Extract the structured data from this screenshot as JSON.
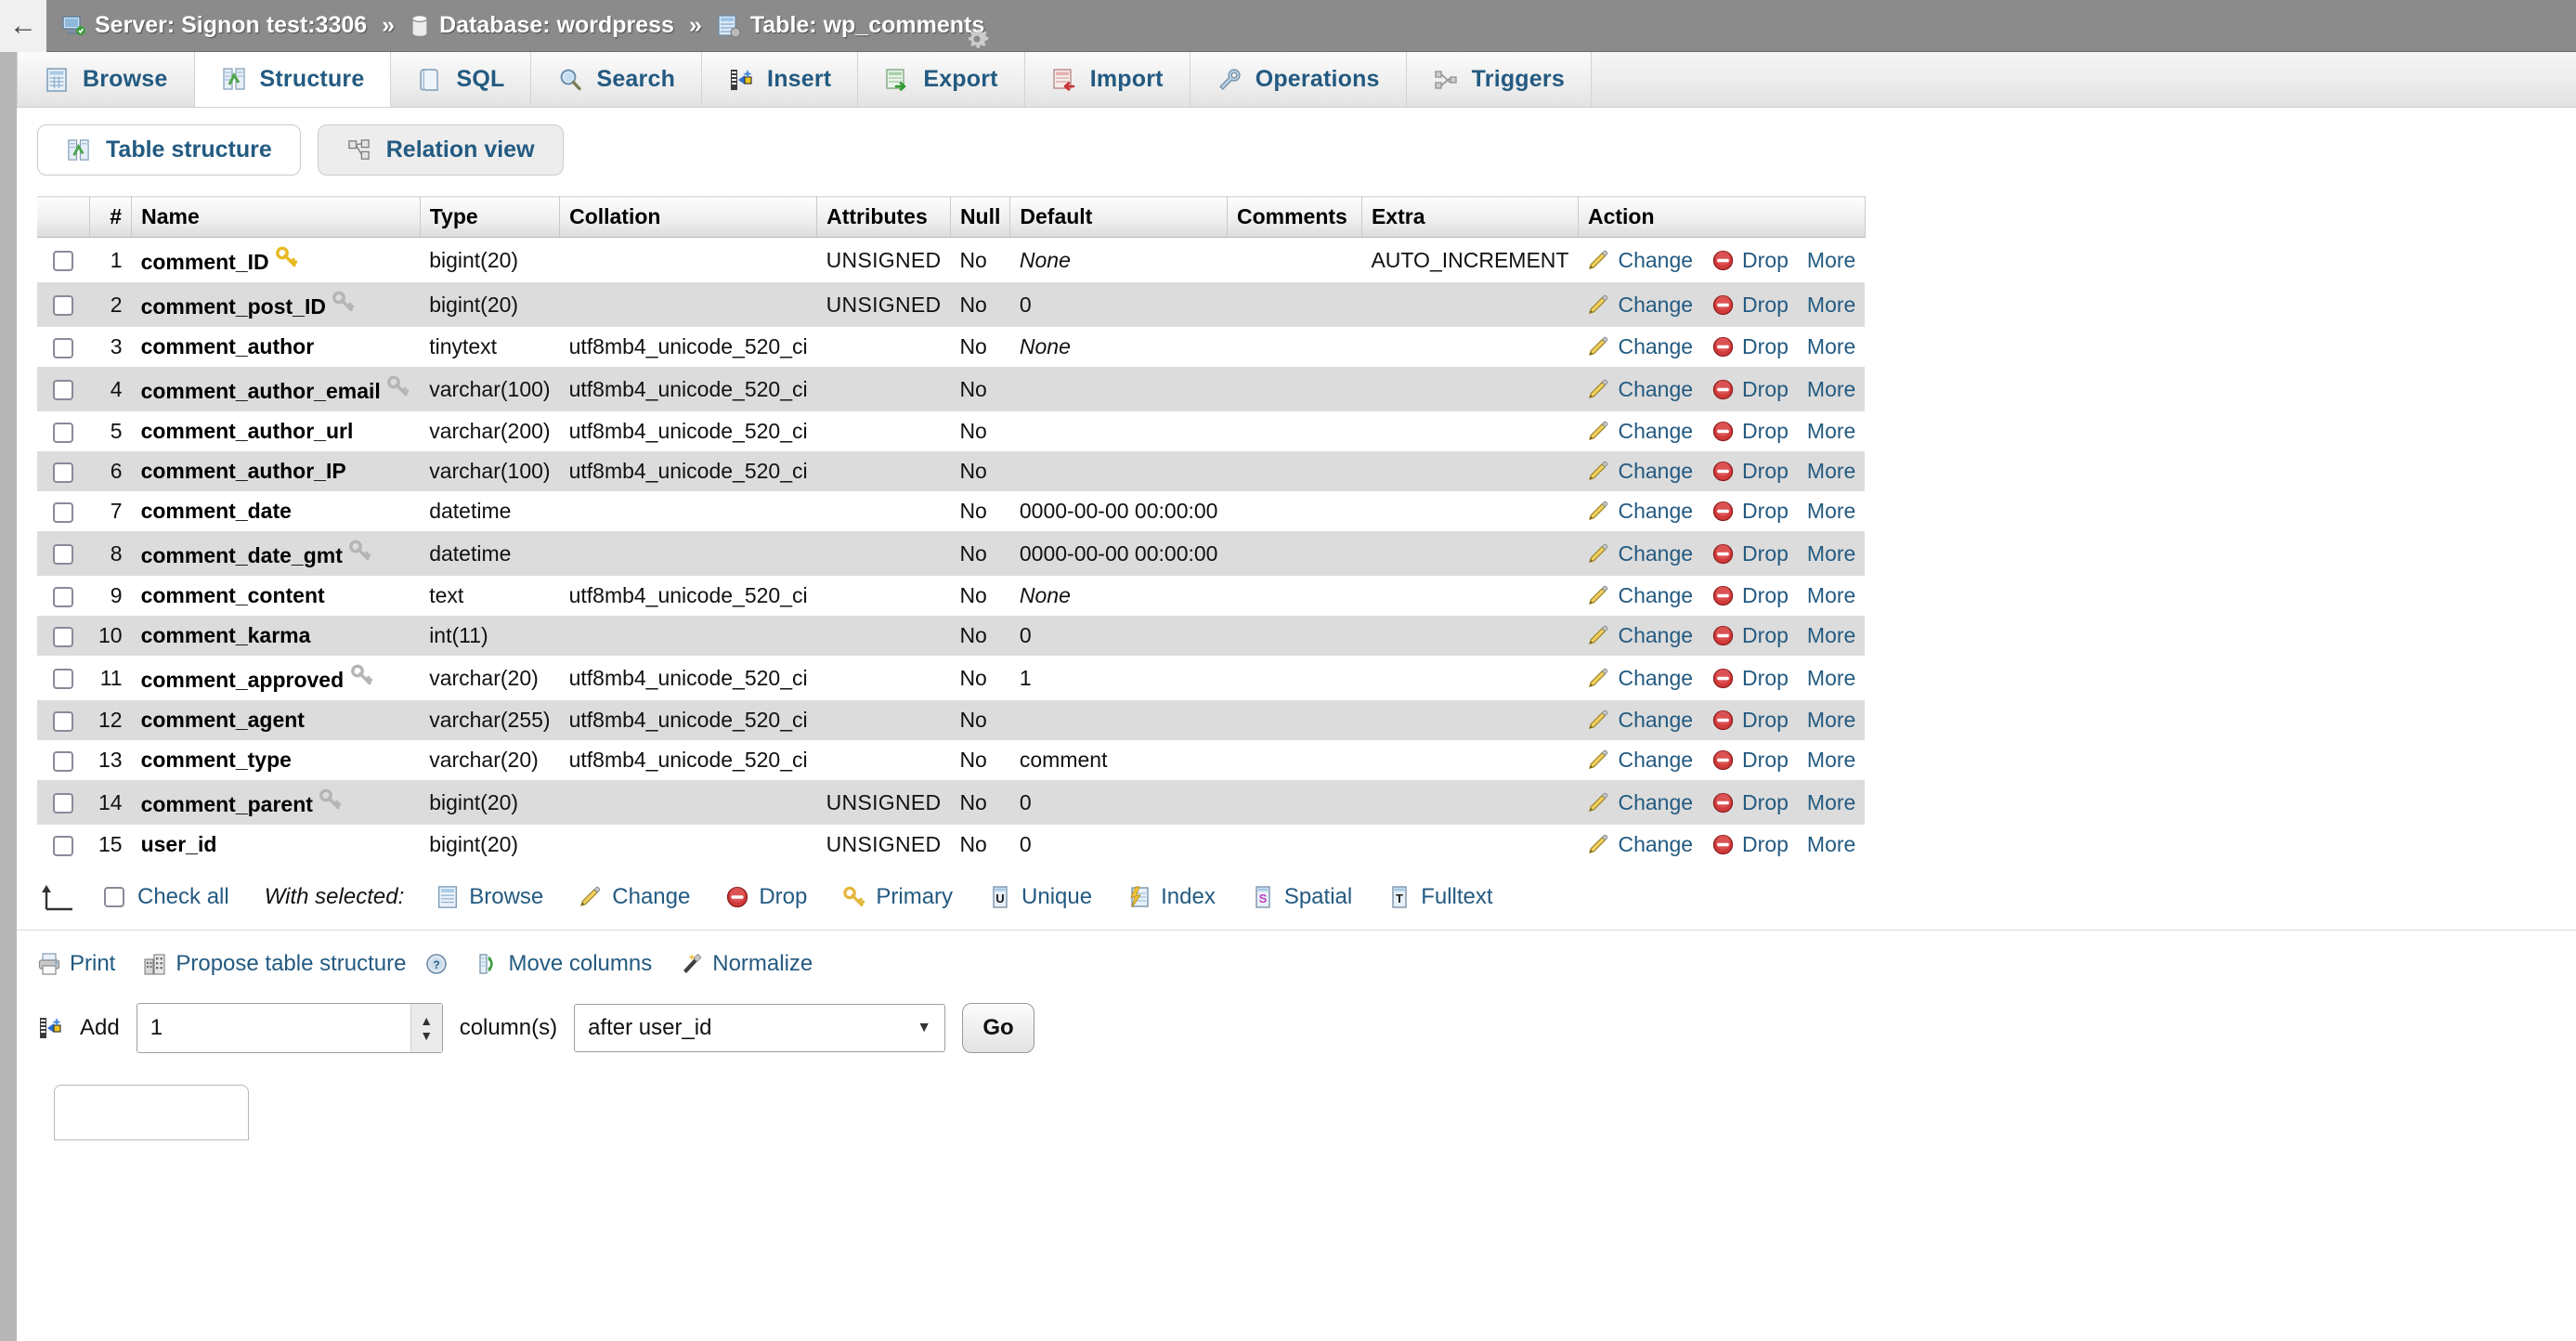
{
  "breadcrumb": {
    "back_icon": "back-arrow-icon",
    "items": [
      {
        "icon": "server-icon",
        "label": "Server: Signon test:3306"
      },
      {
        "icon": "database-icon",
        "label": "Database: wordpress"
      },
      {
        "icon": "table-icon",
        "label": "Table: wp_comments"
      }
    ],
    "separator": "»",
    "settings_icon": "gear-icon"
  },
  "nav_tabs": [
    {
      "label": "Browse",
      "icon": "browse-icon",
      "active": false
    },
    {
      "label": "Structure",
      "icon": "structure-icon",
      "active": true
    },
    {
      "label": "SQL",
      "icon": "sql-icon",
      "active": false
    },
    {
      "label": "Search",
      "icon": "search-icon",
      "active": false
    },
    {
      "label": "Insert",
      "icon": "insert-icon",
      "active": false
    },
    {
      "label": "Export",
      "icon": "export-icon",
      "active": false
    },
    {
      "label": "Import",
      "icon": "import-icon",
      "active": false
    },
    {
      "label": "Operations",
      "icon": "operations-icon",
      "active": false
    },
    {
      "label": "Triggers",
      "icon": "triggers-icon",
      "active": false
    }
  ],
  "sub_tabs": [
    {
      "label": "Table structure",
      "icon": "structure-icon",
      "active": true
    },
    {
      "label": "Relation view",
      "icon": "relation-icon",
      "active": false
    }
  ],
  "table": {
    "columns": [
      "#",
      "Name",
      "Type",
      "Collation",
      "Attributes",
      "Null",
      "Default",
      "Comments",
      "Extra",
      "Action"
    ],
    "action_labels": {
      "change": "Change",
      "drop": "Drop",
      "more": "More"
    },
    "rows": [
      {
        "num": "1",
        "name": "comment_ID",
        "key": "primary",
        "type": "bigint(20)",
        "collation": "",
        "attributes": "UNSIGNED",
        "null": "No",
        "default": "None",
        "default_italic": true,
        "comments": "",
        "extra": "AUTO_INCREMENT"
      },
      {
        "num": "2",
        "name": "comment_post_ID",
        "key": "index",
        "type": "bigint(20)",
        "collation": "",
        "attributes": "UNSIGNED",
        "null": "No",
        "default": "0",
        "default_italic": false,
        "comments": "",
        "extra": ""
      },
      {
        "num": "3",
        "name": "comment_author",
        "key": "none",
        "type": "tinytext",
        "collation": "utf8mb4_unicode_520_ci",
        "attributes": "",
        "null": "No",
        "default": "None",
        "default_italic": true,
        "comments": "",
        "extra": ""
      },
      {
        "num": "4",
        "name": "comment_author_email",
        "key": "index",
        "type": "varchar(100)",
        "collation": "utf8mb4_unicode_520_ci",
        "attributes": "",
        "null": "No",
        "default": "",
        "default_italic": false,
        "comments": "",
        "extra": ""
      },
      {
        "num": "5",
        "name": "comment_author_url",
        "key": "none",
        "type": "varchar(200)",
        "collation": "utf8mb4_unicode_520_ci",
        "attributes": "",
        "null": "No",
        "default": "",
        "default_italic": false,
        "comments": "",
        "extra": ""
      },
      {
        "num": "6",
        "name": "comment_author_IP",
        "key": "none",
        "type": "varchar(100)",
        "collation": "utf8mb4_unicode_520_ci",
        "attributes": "",
        "null": "No",
        "default": "",
        "default_italic": false,
        "comments": "",
        "extra": ""
      },
      {
        "num": "7",
        "name": "comment_date",
        "key": "none",
        "type": "datetime",
        "collation": "",
        "attributes": "",
        "null": "No",
        "default": "0000-00-00 00:00:00",
        "default_italic": false,
        "comments": "",
        "extra": ""
      },
      {
        "num": "8",
        "name": "comment_date_gmt",
        "key": "index",
        "type": "datetime",
        "collation": "",
        "attributes": "",
        "null": "No",
        "default": "0000-00-00 00:00:00",
        "default_italic": false,
        "comments": "",
        "extra": ""
      },
      {
        "num": "9",
        "name": "comment_content",
        "key": "none",
        "type": "text",
        "collation": "utf8mb4_unicode_520_ci",
        "attributes": "",
        "null": "No",
        "default": "None",
        "default_italic": true,
        "comments": "",
        "extra": ""
      },
      {
        "num": "10",
        "name": "comment_karma",
        "key": "none",
        "type": "int(11)",
        "collation": "",
        "attributes": "",
        "null": "No",
        "default": "0",
        "default_italic": false,
        "comments": "",
        "extra": ""
      },
      {
        "num": "11",
        "name": "comment_approved",
        "key": "index",
        "type": "varchar(20)",
        "collation": "utf8mb4_unicode_520_ci",
        "attributes": "",
        "null": "No",
        "default": "1",
        "default_italic": false,
        "comments": "",
        "extra": ""
      },
      {
        "num": "12",
        "name": "comment_agent",
        "key": "none",
        "type": "varchar(255)",
        "collation": "utf8mb4_unicode_520_ci",
        "attributes": "",
        "null": "No",
        "default": "",
        "default_italic": false,
        "comments": "",
        "extra": ""
      },
      {
        "num": "13",
        "name": "comment_type",
        "key": "none",
        "type": "varchar(20)",
        "collation": "utf8mb4_unicode_520_ci",
        "attributes": "",
        "null": "No",
        "default": "comment",
        "default_italic": false,
        "comments": "",
        "extra": ""
      },
      {
        "num": "14",
        "name": "comment_parent",
        "key": "index",
        "type": "bigint(20)",
        "collation": "",
        "attributes": "UNSIGNED",
        "null": "No",
        "default": "0",
        "default_italic": false,
        "comments": "",
        "extra": ""
      },
      {
        "num": "15",
        "name": "user_id",
        "key": "none",
        "type": "bigint(20)",
        "collation": "",
        "attributes": "UNSIGNED",
        "null": "No",
        "default": "0",
        "default_italic": false,
        "comments": "",
        "extra": ""
      }
    ]
  },
  "with_selected": {
    "check_all": "Check all",
    "label": "With selected:",
    "actions": [
      {
        "label": "Browse",
        "icon": "browse-icon"
      },
      {
        "label": "Change",
        "icon": "pencil-icon"
      },
      {
        "label": "Drop",
        "icon": "drop-icon"
      },
      {
        "label": "Primary",
        "icon": "key-gold-icon"
      },
      {
        "label": "Unique",
        "icon": "unique-icon"
      },
      {
        "label": "Index",
        "icon": "index-icon"
      },
      {
        "label": "Spatial",
        "icon": "spatial-icon"
      },
      {
        "label": "Fulltext",
        "icon": "fulltext-icon"
      }
    ]
  },
  "bottom_tools": [
    {
      "label": "Print",
      "icon": "print-icon"
    },
    {
      "label": "Propose table structure",
      "icon": "propose-icon",
      "help_icon": "help-icon"
    },
    {
      "label": "Move columns",
      "icon": "move-columns-icon"
    },
    {
      "label": "Normalize",
      "icon": "normalize-icon"
    }
  ],
  "add_form": {
    "icon": "insert-icon",
    "add_label": "Add",
    "count_value": "1",
    "columns_label": "column(s)",
    "position_value": "after user_id",
    "go_label": "Go"
  },
  "colors": {
    "link": "#235a81",
    "breadcrumb_bg": "#8b8b8b",
    "row_even": "#dcdcdc",
    "gold": "#e8b923",
    "red": "#cc2b2b"
  }
}
